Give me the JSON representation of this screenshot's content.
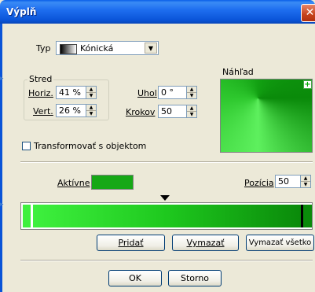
{
  "window": {
    "title": "Výplň"
  },
  "type_row": {
    "label": "Typ",
    "selected": "Kónická"
  },
  "center": {
    "group_label": "Stred",
    "horiz_label": "Horiz.",
    "horiz_value": "41 %",
    "vert_label": "Vert.",
    "vert_value": "26 %"
  },
  "angle": {
    "label": "Uhol",
    "value": "0 °"
  },
  "steps": {
    "label": "Krokov",
    "value": "50"
  },
  "preview": {
    "label": "Náhľad",
    "add_glyph": "+"
  },
  "transform": {
    "label": "Transformovať s objektom",
    "checked": false
  },
  "active": {
    "label": "Aktívne",
    "color": "#16a816"
  },
  "position": {
    "label": "Pozícia",
    "value": "50"
  },
  "buttons": {
    "add": "Pridať",
    "delete": "Vymazať",
    "delete_all": "Vymazať všetko",
    "ok": "OK",
    "cancel": "Storno"
  },
  "colors": {
    "gradient_start": "#3ef03e",
    "gradient_end": "#0a8a0a",
    "title_bar": "#0a5ee8"
  }
}
